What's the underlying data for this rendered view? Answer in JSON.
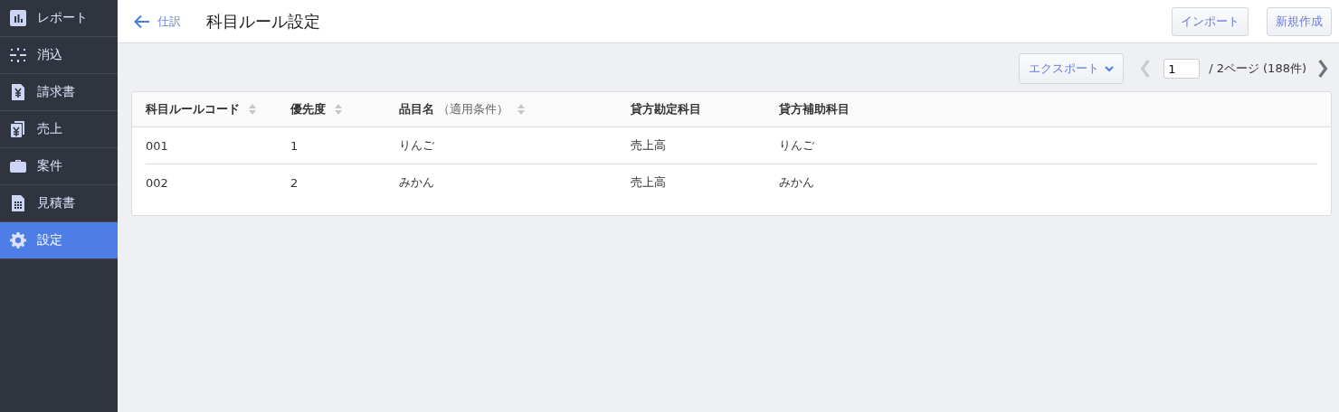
{
  "sidebar": {
    "items": [
      {
        "label": "レポート",
        "selected": false
      },
      {
        "label": "消込",
        "selected": false
      },
      {
        "label": "請求書",
        "selected": false
      },
      {
        "label": "売上",
        "selected": false
      },
      {
        "label": "案件",
        "selected": false
      },
      {
        "label": "見積書",
        "selected": false
      },
      {
        "label": "設定",
        "selected": true
      }
    ]
  },
  "header": {
    "back_link": "仕訳",
    "title": "科目ルール設定",
    "buttons": [
      "インポート",
      "新規作成"
    ]
  },
  "toolbar": {
    "export_button": "エクスポート",
    "pagination": {
      "prev_disabled": true,
      "next_disabled": false,
      "page": "1",
      "total": "/ 2ページ (188件)"
    }
  },
  "table": {
    "columns": [
      {
        "label": "科目ルールコード",
        "sortable": true
      },
      {
        "label": "優先度",
        "sortable": true
      },
      {
        "label": "品目名",
        "note": "（適用条件）",
        "sortable": true
      },
      {
        "label": "貸方勘定科目",
        "sortable": false
      },
      {
        "label": "貸方補助科目",
        "sortable": false
      }
    ],
    "rows": [
      [
        "001",
        "1",
        "りんご",
        "売上高",
        "りんご"
      ],
      [
        "002",
        "2",
        "みかん",
        "売上高",
        "みかん"
      ]
    ]
  }
}
